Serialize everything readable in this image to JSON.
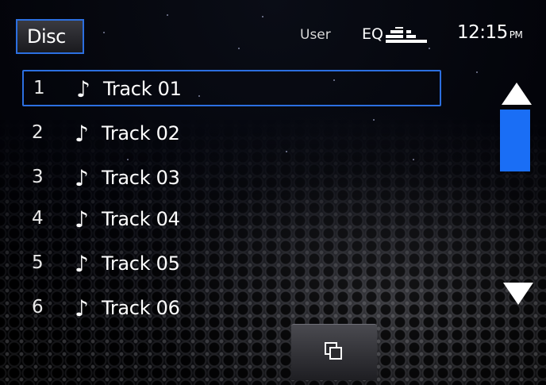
{
  "header": {
    "source_label": "Disc",
    "eq_mode": "User",
    "eq_label": "EQ",
    "eq_icon": "equalizer-bars-icon",
    "clock_time": "12:15",
    "clock_ampm": "PM"
  },
  "tracks": [
    {
      "number": "1",
      "name": "Track 01",
      "icon": "music-note-icon"
    },
    {
      "number": "2",
      "name": "Track 02",
      "icon": "music-note-icon"
    },
    {
      "number": "3",
      "name": "Track 03",
      "icon": "music-note-icon"
    },
    {
      "number": "4",
      "name": "Track 04",
      "icon": "music-note-icon"
    },
    {
      "number": "5",
      "name": "Track 05",
      "icon": "music-note-icon"
    },
    {
      "number": "6",
      "name": "Track 06",
      "icon": "music-note-icon"
    }
  ],
  "selected_track_index": 0,
  "note_glyph": "♪",
  "scrollbar": {
    "up_icon": "scroll-up-arrow-icon",
    "down_icon": "scroll-down-arrow-icon"
  },
  "bottom": {
    "browse_icon": "overlapping-squares-icon"
  },
  "colors": {
    "accent": "#2c6fe0",
    "scroll_thumb": "#1a6ef5",
    "text": "#ffffff",
    "background": "#000000"
  }
}
